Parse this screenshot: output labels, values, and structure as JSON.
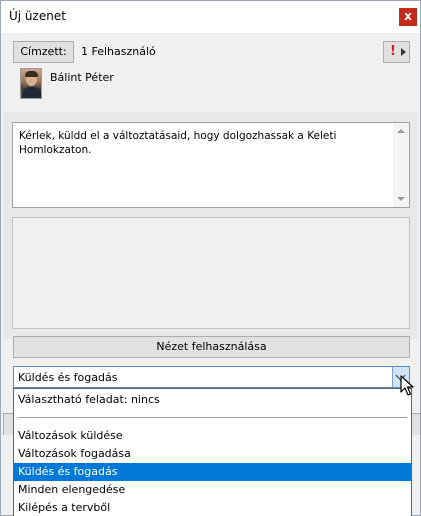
{
  "window": {
    "title": "Új üzenet",
    "close_label": "x"
  },
  "recipients": {
    "button_label": "Címzett:",
    "count_text": "1 Felhasználó",
    "list": [
      {
        "name": "Bálint Péter"
      }
    ],
    "priority_label": "!"
  },
  "message": {
    "text": "Kérlek, küldd el a változtatásaid, hogy dolgozhassak a Keleti\nHomlokzaton."
  },
  "view_button_label": "Nézet felhasználása",
  "task_combo": {
    "selected": "Küldés és fogadás",
    "options": [
      "Választható feladat: nincs",
      "Változások küldése",
      "Változások fogadása",
      "Küldés és fogadás",
      "Minden elengedése",
      "Kilépés a tervből"
    ],
    "highlighted_index": 3
  },
  "colors": {
    "accent": "#0078d7",
    "close_bg": "#c42b1c",
    "priority": "#d61f1f"
  }
}
